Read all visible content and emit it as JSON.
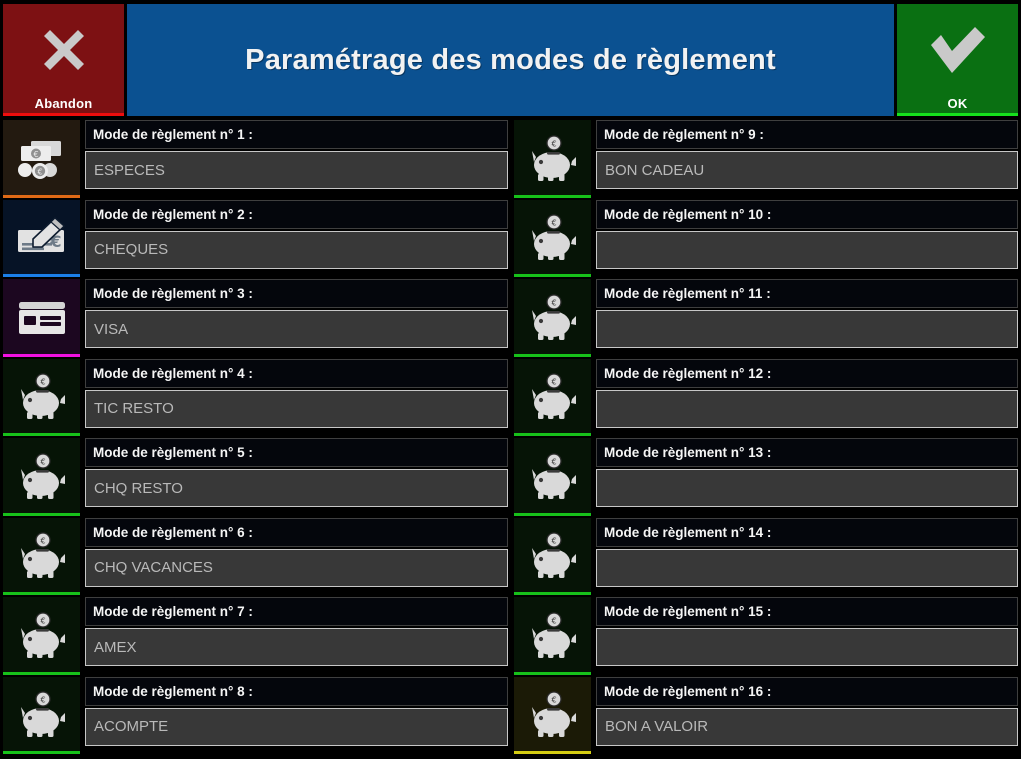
{
  "topbar": {
    "abandon_label": "Abandon",
    "abandon_icon": "close-x-icon",
    "title": "Paramétrage des modes de règlement",
    "ok_label": "OK",
    "ok_icon": "check-icon",
    "colors": {
      "abandon_bg": "#7d1113",
      "abandon_accent": "#ee0d0d",
      "title_bg": "#0b5191",
      "ok_bg": "#0a7012",
      "ok_accent": "#16e21c"
    }
  },
  "colors": {
    "page_bg": "#000000",
    "label_bg": "#04060c",
    "label_border": "#3f3f3f",
    "input_bg": "#383838",
    "input_border": "#c7c7c7",
    "label_text": "#f5f5f5",
    "input_text": "#b9b9b9"
  },
  "rows": [
    {
      "label": "Mode de règlement n° 1 :",
      "value": "ESPECES",
      "icon": "cash-banknote-coins-icon",
      "tile_bg": "#231a10",
      "accent": "#e06a16"
    },
    {
      "label": "Mode de règlement n° 2 :",
      "value": "CHEQUES",
      "icon": "cheque-pen-icon",
      "tile_bg": "#061326",
      "accent": "#1b7fe8"
    },
    {
      "label": "Mode de règlement n° 3 :",
      "value": "VISA",
      "icon": "credit-card-icon",
      "tile_bg": "#1c0720",
      "accent": "#f211e2"
    },
    {
      "label": "Mode de règlement n° 4 :",
      "value": "TIC RESTO",
      "icon": "piggy-bank-icon",
      "tile_bg": "#061406",
      "accent": "#17c21a"
    },
    {
      "label": "Mode de règlement n° 5 :",
      "value": "CHQ RESTO",
      "icon": "piggy-bank-icon",
      "tile_bg": "#061406",
      "accent": "#17c21a"
    },
    {
      "label": "Mode de règlement n° 6 :",
      "value": "CHQ VACANCES",
      "icon": "piggy-bank-icon",
      "tile_bg": "#061406",
      "accent": "#17c21a"
    },
    {
      "label": "Mode de règlement n° 7 :",
      "value": "AMEX",
      "icon": "piggy-bank-icon",
      "tile_bg": "#061406",
      "accent": "#17c21a"
    },
    {
      "label": "Mode de règlement n° 8 :",
      "value": "ACOMPTE",
      "icon": "piggy-bank-icon",
      "tile_bg": "#061406",
      "accent": "#17c21a"
    },
    {
      "label": "Mode de règlement n° 9 :",
      "value": "BON CADEAU",
      "icon": "piggy-bank-icon",
      "tile_bg": "#061406",
      "accent": "#17c21a"
    },
    {
      "label": "Mode de règlement n° 10 :",
      "value": "",
      "icon": "piggy-bank-icon",
      "tile_bg": "#061406",
      "accent": "#17c21a"
    },
    {
      "label": "Mode de règlement n° 11 :",
      "value": "",
      "icon": "piggy-bank-icon",
      "tile_bg": "#061406",
      "accent": "#17c21a"
    },
    {
      "label": "Mode de règlement n° 12 :",
      "value": "",
      "icon": "piggy-bank-icon",
      "tile_bg": "#061406",
      "accent": "#17c21a"
    },
    {
      "label": "Mode de règlement n° 13 :",
      "value": "",
      "icon": "piggy-bank-icon",
      "tile_bg": "#061406",
      "accent": "#17c21a"
    },
    {
      "label": "Mode de règlement n° 14 :",
      "value": "",
      "icon": "piggy-bank-icon",
      "tile_bg": "#061406",
      "accent": "#17c21a"
    },
    {
      "label": "Mode de règlement n° 15 :",
      "value": "",
      "icon": "piggy-bank-icon",
      "tile_bg": "#061406",
      "accent": "#17c21a"
    },
    {
      "label": "Mode de règlement n° 16 :",
      "value": "BON A VALOIR",
      "icon": "piggy-bank-icon",
      "tile_bg": "#1b1a06",
      "accent": "#d4cc12"
    }
  ]
}
